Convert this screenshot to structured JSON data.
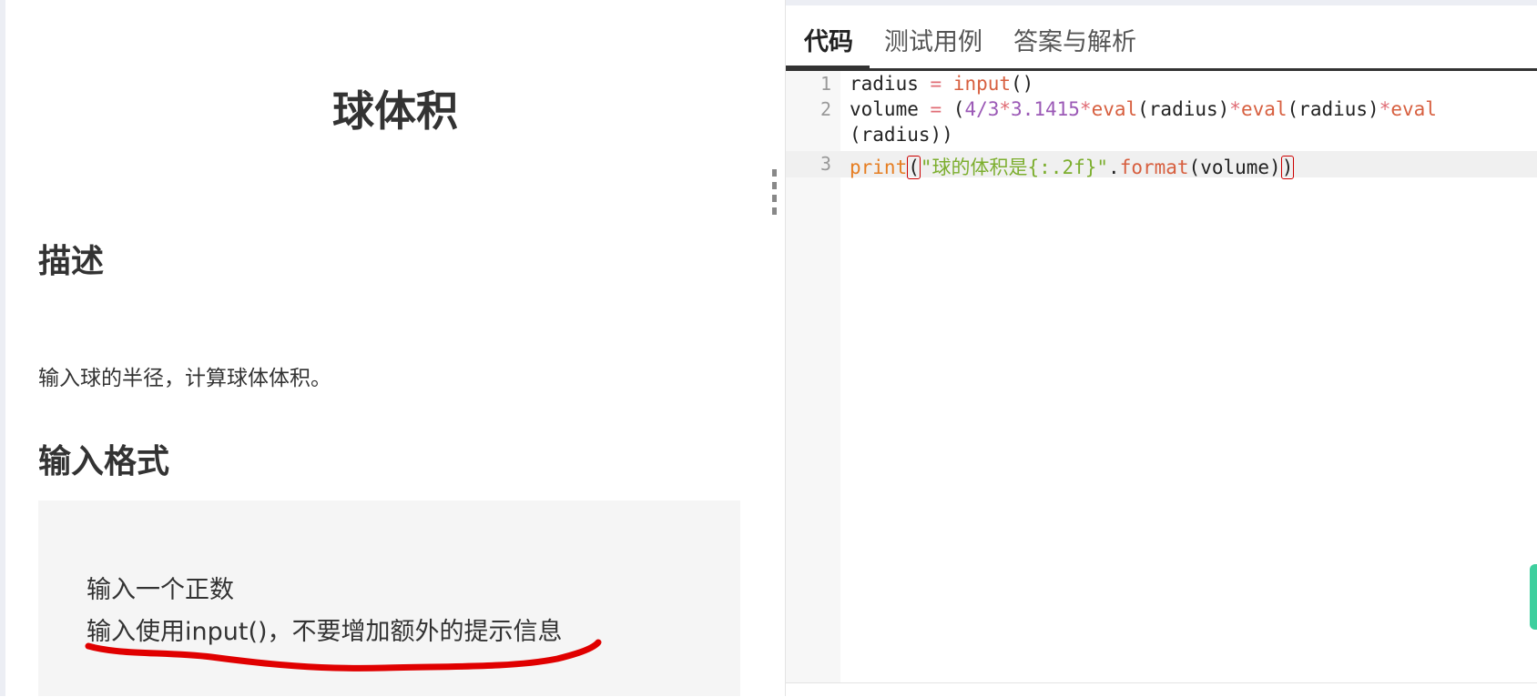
{
  "problem": {
    "title": "球体积",
    "description_heading": "描述",
    "description_text": "输入球的半径，计算球体体积。",
    "input_format_heading": "输入格式",
    "input_format_lines": [
      "输入一个正数",
      "输入使用input()，不要增加额外的提示信息"
    ]
  },
  "tabs": [
    {
      "label": "代码",
      "active": true
    },
    {
      "label": "测试用例",
      "active": false
    },
    {
      "label": "答案与解析",
      "active": false
    }
  ],
  "editor": {
    "line_numbers": [
      "1",
      "2",
      "3"
    ],
    "lines": {
      "l1": {
        "a": "radius",
        "b": " = ",
        "c": "input",
        "d": "()"
      },
      "l2": {
        "a": "volume",
        "b": " = ",
        "c": "(",
        "d": "4/3",
        "e": "*",
        "f": "3.1415",
        "g": "*",
        "h": "eval",
        "i": "(radius)",
        "j": "*",
        "k": "eval",
        "l": "(radius)",
        "m": "*",
        "n": "eval"
      },
      "l2b": {
        "a": "(radius))"
      },
      "l3": {
        "a": "print",
        "b": "(",
        "c": "\"球的体积是{:.2f}\"",
        "d": ".",
        "e": "format",
        "f": "(volume)",
        "g": ")"
      }
    }
  },
  "colors": {
    "accent_green": "#3ecf9e",
    "underline_red": "#e00000"
  }
}
